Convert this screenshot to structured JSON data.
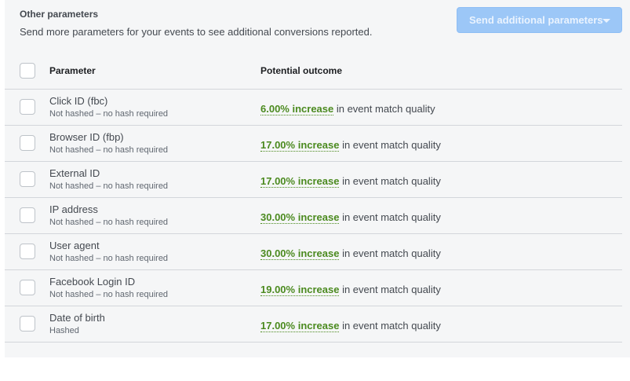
{
  "section": {
    "title": "Other parameters",
    "subtitle": "Send more parameters for your events to see additional conversions reported.",
    "send_button_label": "Send additional parameters"
  },
  "table": {
    "headers": {
      "parameter": "Parameter",
      "outcome": "Potential outcome"
    },
    "rows": [
      {
        "name": "Click ID (fbc)",
        "hash": "Not hashed – no hash required",
        "increase": "6.00% increase",
        "suffix": " in event match quality"
      },
      {
        "name": "Browser ID (fbp)",
        "hash": "Not hashed – no hash required",
        "increase": "17.00% increase",
        "suffix": " in event match quality"
      },
      {
        "name": "External ID",
        "hash": "Not hashed – no hash required",
        "increase": "17.00% increase",
        "suffix": " in event match quality"
      },
      {
        "name": "IP address",
        "hash": "Not hashed – no hash required",
        "increase": "30.00% increase",
        "suffix": " in event match quality"
      },
      {
        "name": "User agent",
        "hash": "Not hashed – no hash required",
        "increase": "30.00% increase",
        "suffix": " in event match quality"
      },
      {
        "name": "Facebook Login ID",
        "hash": "Not hashed – no hash required",
        "increase": "19.00% increase",
        "suffix": " in event match quality"
      },
      {
        "name": "Date of birth",
        "hash": "Hashed",
        "increase": "17.00% increase",
        "suffix": " in event match quality"
      }
    ]
  },
  "colors": {
    "accent_green": "#4b8a1f",
    "button_disabled_blue": "#9cc7f7",
    "panel_background": "#f5f6f7"
  },
  "icons": {
    "dropdown": "caret-down-icon",
    "checkbox": "checkbox-unchecked"
  }
}
